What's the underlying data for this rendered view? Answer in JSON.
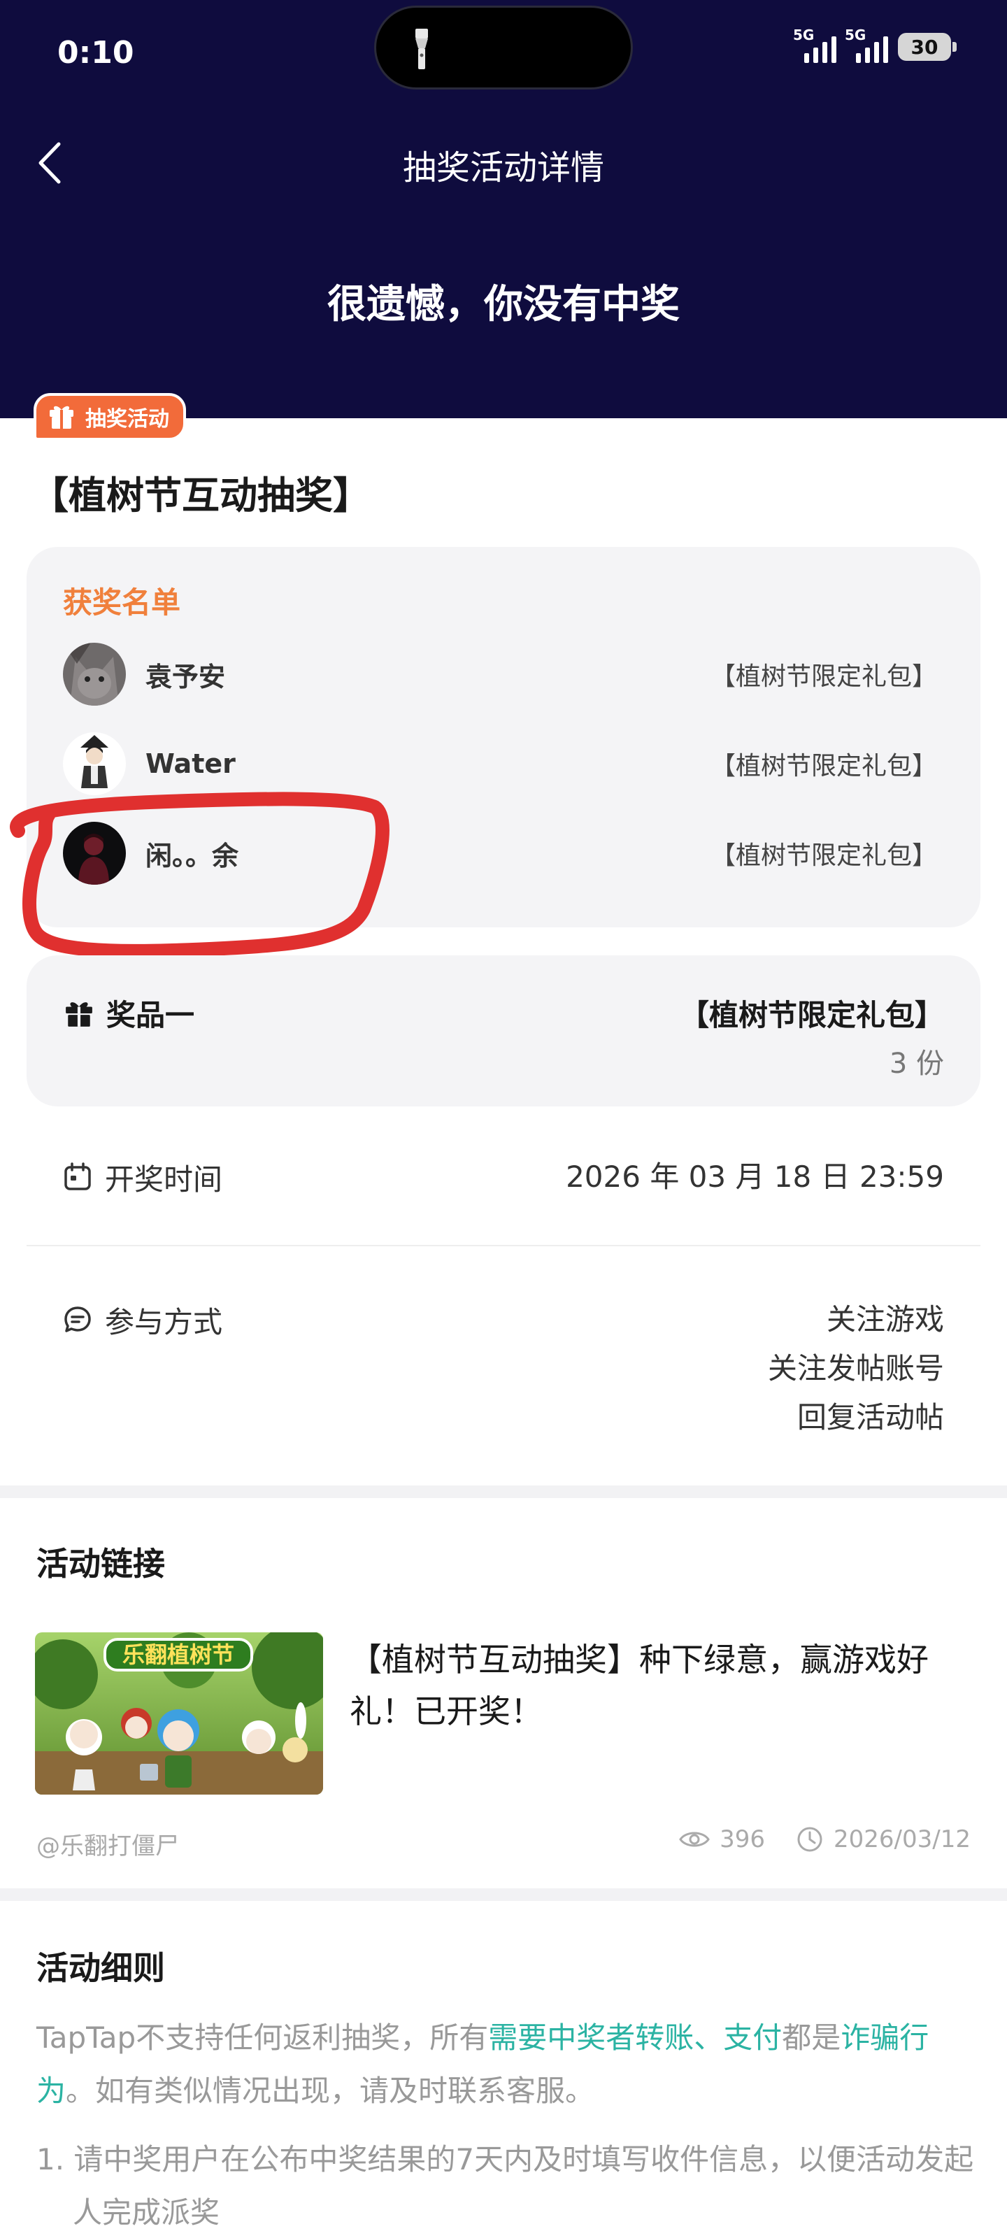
{
  "status_bar": {
    "time": "0:10",
    "network_1": "5G",
    "network_2": "5G",
    "battery": "30"
  },
  "header": {
    "title": "抽奖活动详情",
    "result": "很遗憾，你没有中奖",
    "background": "#0f0c3e"
  },
  "badge": {
    "label": "抽奖活动",
    "color": "#f26b3a"
  },
  "activity": {
    "title": "【植树节互动抽奖】"
  },
  "winners": {
    "heading": "获奖名单",
    "list": [
      {
        "name": "袁予安",
        "prize": "【植树节限定礼包】"
      },
      {
        "name": "Water",
        "prize": "【植树节限定礼包】"
      },
      {
        "name": "闲。。余",
        "prize": "【植树节限定礼包】"
      }
    ]
  },
  "prize": {
    "label": "奖品一",
    "name": "【植树节限定礼包】",
    "count": "3 份"
  },
  "draw_time": {
    "label": "开奖时间",
    "value": "2026 年 03 月 18 日 23:59"
  },
  "participation": {
    "label": "参与方式",
    "methods": [
      "关注游戏",
      "关注发帖账号",
      "回复活动帖"
    ]
  },
  "activity_link": {
    "section_title": "活动链接",
    "thumb_caption": "乐翻植树节",
    "title": "【植树节互动抽奖】种下绿意，赢游戏好礼！已开奖！",
    "author": "@乐翻打僵尸",
    "views": "396",
    "date": "2026/03/12"
  },
  "rules": {
    "section_title": "活动细则",
    "p_part1": "TapTap不支持任何返利抽奖，所有",
    "p_highlight1": "需要中奖者转账、支付",
    "p_part2": "都是",
    "p_highlight2": "诈骗行为",
    "p_part3": "。如有类似情况出现，请及时联系客服。",
    "item1": "1. 请中奖用户在公布中奖结果的7天内及时填写收件信息，以便活动发起人完成派奖"
  },
  "colors": {
    "accent_orange": "#f0803c",
    "teal": "#2bb3a3",
    "annotation_red": "#e0302f"
  }
}
